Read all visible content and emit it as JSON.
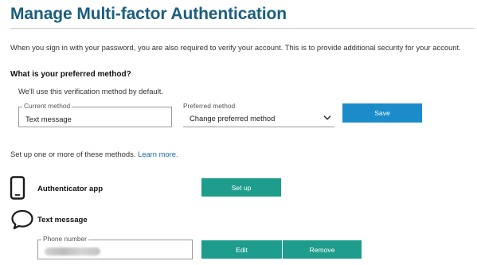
{
  "header": {
    "title": "Manage Multi-factor Authentication"
  },
  "intro": "When you sign in with your password, you are also required to verify your account. This is to provide additional security for your account.",
  "preferred_section": {
    "heading": "What is your preferred method?",
    "subtext": "We'll use this verification method by default.",
    "current_method": {
      "label": "Current method",
      "value": "Text message"
    },
    "preferred_method": {
      "label": "Preferred method",
      "selected": "Change preferred method"
    },
    "save_label": "Save"
  },
  "setup": {
    "text": "Set up one or more of these methods.",
    "learn_more": "Learn more."
  },
  "methods": {
    "authenticator": {
      "name": "Authenticator app",
      "icon": "smartphone-icon",
      "action_label": "Set up"
    },
    "text_message": {
      "name": "Text message",
      "icon": "chat-bubble-icon",
      "phone_label": "Phone number",
      "edit_label": "Edit",
      "remove_label": "Remove"
    }
  },
  "colors": {
    "title": "#1a5e7e",
    "save_button": "#1b8cc9",
    "action_button": "#1e9c8c",
    "link": "#1a6da8"
  }
}
